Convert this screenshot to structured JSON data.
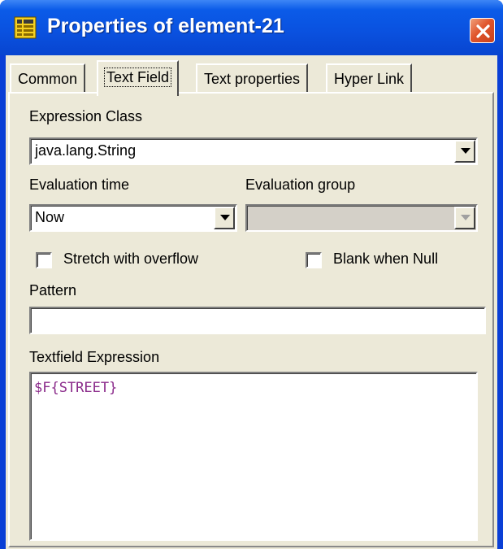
{
  "window": {
    "title": "Properties of element-21",
    "icon": "report-icon",
    "close_icon": "close-icon"
  },
  "tabs": [
    {
      "label": "Common",
      "active": false
    },
    {
      "label": "Text Field",
      "active": true
    },
    {
      "label": "Text properties",
      "active": false
    },
    {
      "label": "Hyper Link",
      "active": false
    }
  ],
  "form": {
    "expression_class_label": "Expression Class",
    "expression_class_value": "java.lang.String",
    "evaluation_time_label": "Evaluation time",
    "evaluation_time_value": "Now",
    "evaluation_group_label": "Evaluation group",
    "evaluation_group_value": "",
    "stretch_label": "Stretch with overflow",
    "stretch_checked": false,
    "blank_label": "Blank when Null",
    "blank_checked": false,
    "pattern_label": "Pattern",
    "pattern_value": "",
    "expression_label": "Textfield Expression",
    "expression_value": "$F{STREET}"
  },
  "colors": {
    "titlebar": "#0b5be8",
    "dialog_face": "#ece9d8",
    "close_button": "#e0562d",
    "expression_text": "#8a2a8a"
  }
}
